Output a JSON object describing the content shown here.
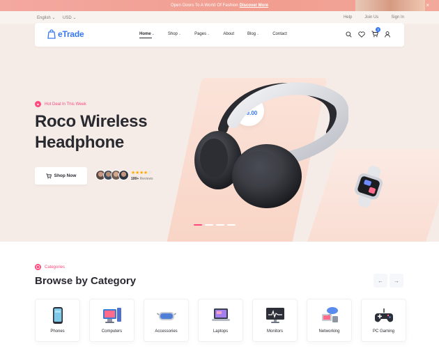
{
  "announcement": {
    "message": "Open Doors To A World Of Fashion",
    "link": "Discover More"
  },
  "utility": {
    "language": "English",
    "currency": "USD",
    "links": [
      "Help",
      "Join Us",
      "Sign In"
    ]
  },
  "nav": {
    "logo": "eTrade",
    "menu": [
      {
        "label": "Home",
        "has_dropdown": true,
        "active": true
      },
      {
        "label": "Shop",
        "has_dropdown": true
      },
      {
        "label": "Pages",
        "has_dropdown": true
      },
      {
        "label": "About",
        "has_dropdown": false
      },
      {
        "label": "Blog",
        "has_dropdown": true
      },
      {
        "label": "Contact",
        "has_dropdown": false
      }
    ],
    "icons": [
      "search-icon",
      "heart-icon",
      "cart-icon",
      "user-icon"
    ],
    "cart_count": "3"
  },
  "hero": {
    "tag": "Hot Deal In This Week",
    "title": "Roco Wireless Headphone",
    "cta": "Shop Now",
    "rating_stars": 4,
    "reviews": "100+",
    "reviews_label": "Reviews",
    "price_from": "From",
    "price": "$49.00",
    "slide_index": 1,
    "slide_count": 4
  },
  "categories": {
    "tag": "Categories",
    "title": "Browse by Category",
    "items": [
      {
        "label": "Phones",
        "icon": "phone-icon"
      },
      {
        "label": "Computers",
        "icon": "computer-icon"
      },
      {
        "label": "Accessories",
        "icon": "vr-headset-icon"
      },
      {
        "label": "Laptops",
        "icon": "laptop-icon"
      },
      {
        "label": "Monitors",
        "icon": "monitor-icon"
      },
      {
        "label": "Networking",
        "icon": "networking-icon"
      },
      {
        "label": "PC Gaming",
        "icon": "gamepad-icon"
      }
    ]
  },
  "colors": {
    "primary": "#3577f0",
    "accent": "#ff497c",
    "hero_bg": "#f6ece7",
    "star": "#ffa800"
  }
}
